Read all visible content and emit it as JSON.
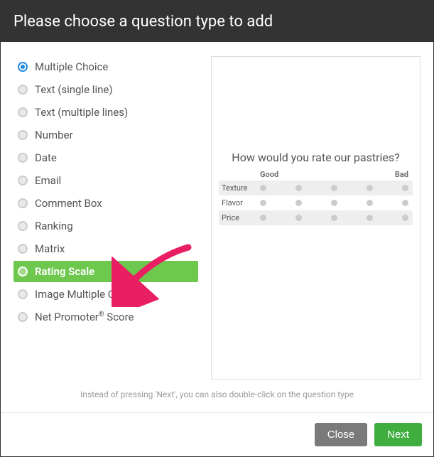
{
  "header": {
    "title": "Please choose a question type to add"
  },
  "types": [
    {
      "label": "Multiple Choice",
      "selected": true,
      "highlighted": false
    },
    {
      "label": "Text (single line)",
      "selected": false,
      "highlighted": false
    },
    {
      "label": "Text (multiple lines)",
      "selected": false,
      "highlighted": false
    },
    {
      "label": "Number",
      "selected": false,
      "highlighted": false
    },
    {
      "label": "Date",
      "selected": false,
      "highlighted": false
    },
    {
      "label": "Email",
      "selected": false,
      "highlighted": false
    },
    {
      "label": "Comment Box",
      "selected": false,
      "highlighted": false
    },
    {
      "label": "Ranking",
      "selected": false,
      "highlighted": false
    },
    {
      "label": "Matrix",
      "selected": false,
      "highlighted": false
    },
    {
      "label": "Rating Scale",
      "selected": false,
      "highlighted": true
    },
    {
      "label": "Image Multiple Choice",
      "selected": false,
      "highlighted": false
    },
    {
      "label": "Net Promoter® Score",
      "selected": false,
      "highlighted": false
    }
  ],
  "preview": {
    "title": "How would you rate our pastries?",
    "scale_left": "Good",
    "scale_right": "Bad",
    "rows": [
      "Texture",
      "Flavor",
      "Price"
    ],
    "columns": 5
  },
  "hint": "Instead of pressing 'Next', you can also double-click on the question type",
  "footer": {
    "close": "Close",
    "next": "Next"
  },
  "annotation": {
    "arrow_color": "#e91e63"
  }
}
